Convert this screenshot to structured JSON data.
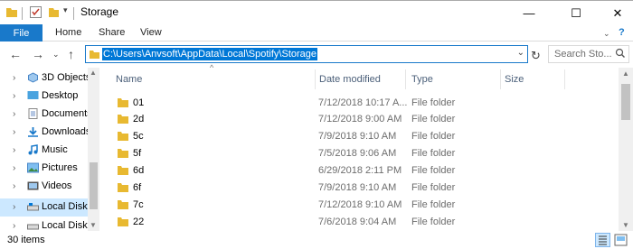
{
  "window": {
    "title": "Storage",
    "controls": {
      "minimize": "—",
      "maximize": "☐",
      "close": "✕"
    }
  },
  "ribbon": {
    "tabs": [
      "File",
      "Home",
      "Share",
      "View"
    ],
    "help_icon": "?"
  },
  "address": {
    "path": "C:\\Users\\Anvsoft\\AppData\\Local\\Spotify\\Storage",
    "search_placeholder": "Search Sto..."
  },
  "nav": {
    "items": [
      {
        "label": "3D Objects",
        "icon": "3d-objects-icon",
        "selected": false
      },
      {
        "label": "Desktop",
        "icon": "desktop-icon",
        "selected": false
      },
      {
        "label": "Documents",
        "icon": "documents-icon",
        "selected": false
      },
      {
        "label": "Downloads",
        "icon": "downloads-icon",
        "selected": false
      },
      {
        "label": "Music",
        "icon": "music-icon",
        "selected": false
      },
      {
        "label": "Pictures",
        "icon": "pictures-icon",
        "selected": false
      },
      {
        "label": "Videos",
        "icon": "videos-icon",
        "selected": false
      },
      {
        "label": "Local Disk (",
        "icon": "local-disk-icon",
        "selected": true
      },
      {
        "label": "Local Disk (",
        "icon": "local-disk-icon",
        "selected": false
      }
    ]
  },
  "filelist": {
    "columns": [
      "Name",
      "Date modified",
      "Type",
      "Size"
    ],
    "rows": [
      {
        "name": "01",
        "date": "7/12/2018 10:17 A...",
        "type": "File folder",
        "size": ""
      },
      {
        "name": "2d",
        "date": "7/12/2018 9:00 AM",
        "type": "File folder",
        "size": ""
      },
      {
        "name": "5c",
        "date": "7/9/2018 9:10 AM",
        "type": "File folder",
        "size": ""
      },
      {
        "name": "5f",
        "date": "7/5/2018 9:06 AM",
        "type": "File folder",
        "size": ""
      },
      {
        "name": "6d",
        "date": "6/29/2018 2:11 PM",
        "type": "File folder",
        "size": ""
      },
      {
        "name": "6f",
        "date": "7/9/2018 9:10 AM",
        "type": "File folder",
        "size": ""
      },
      {
        "name": "7c",
        "date": "7/12/2018 9:10 AM",
        "type": "File folder",
        "size": ""
      },
      {
        "name": "22",
        "date": "7/6/2018 9:04 AM",
        "type": "File folder",
        "size": ""
      }
    ]
  },
  "status": {
    "item_count": "30 items"
  },
  "colors": {
    "accent": "#1979ca",
    "selection": "#cce8ff",
    "folder": "#e8b931"
  }
}
